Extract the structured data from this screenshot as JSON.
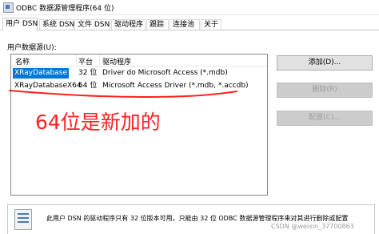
{
  "window": {
    "title": "ODBC 数据源管理程序(64 位)"
  },
  "tabs": [
    "用户 DSN",
    "系统 DSN",
    "文件 DSN",
    "驱动程序",
    "跟踪",
    "连接池",
    "关于"
  ],
  "main": {
    "sources_label": "用户数据源(U):",
    "columns": {
      "name": "名称",
      "platform": "平台",
      "driver": "驱动程序"
    },
    "rows": [
      {
        "name": "XRayDatabase",
        "platform": "32 位",
        "driver": "Driver do Microsoft Access (*.mdb)"
      },
      {
        "name": "XRayDatabaseX64",
        "platform": "64 位",
        "driver": "Microsoft Access Driver (*.mdb, *.accdb)"
      }
    ]
  },
  "buttons": {
    "add": "添加(D)...",
    "remove": "删除(R)",
    "configure": "配置(C)..."
  },
  "annotation": {
    "text": "64位是新加的",
    "color": "#ff2020"
  },
  "info": {
    "text": "此用户 DSN 的驱动程序只有 32 位版本可用。只能由 32 位 ODBC 数据源管理程序来对其进行删除或配置"
  },
  "watermark": "CSDN @weixin_37700863",
  "colors": {
    "selection": "#0078d7",
    "annotation": "#ff2020"
  }
}
